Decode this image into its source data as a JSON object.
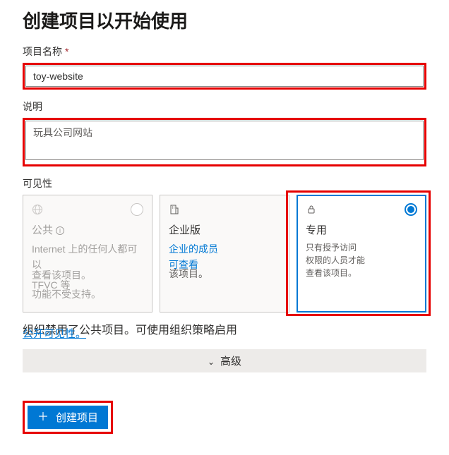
{
  "header": {
    "title": "创建项目以开始使用"
  },
  "fields": {
    "name": {
      "label": "项目名称",
      "required_mark": "*",
      "value": "toy-website"
    },
    "description": {
      "label": "说明",
      "value": "玩具公司网站"
    }
  },
  "visibility": {
    "label": "可见性",
    "options": {
      "public": {
        "icon": "globe-icon",
        "title": "公共",
        "desc_line1": "Internet 上的任何人都可以",
        "desc_line2": "查看该项目。",
        "desc_line3": "TFVC 等",
        "desc_line4": "功能不受支持。",
        "selected": false,
        "disabled": true
      },
      "enterprise": {
        "icon": "building-icon",
        "title": "企业版",
        "link_line1": "企业的成员",
        "link_line2": "可查看",
        "desc_after": "该项目。",
        "selected": false,
        "disabled": false
      },
      "private": {
        "icon": "lock-icon",
        "title": "专用",
        "desc_line1": "只有授予访问",
        "desc_line2": "权限的人员才能",
        "desc_line3": "查看该项目。",
        "selected": true,
        "disabled": false
      }
    }
  },
  "note": {
    "text_line1": "组织禁用了公共项目。可使用组织策略启用",
    "link_text": "公开可见性。"
  },
  "advanced": {
    "label": "高级"
  },
  "actions": {
    "create": "创建项目"
  }
}
